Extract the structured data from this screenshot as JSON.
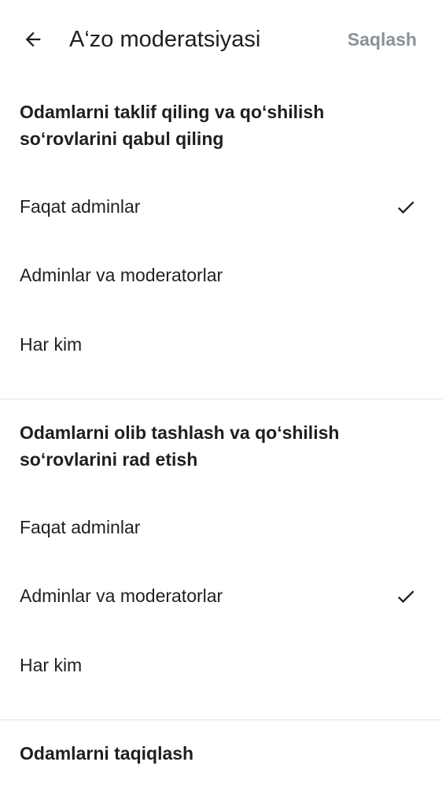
{
  "header": {
    "back_icon": "arrow-left-icon",
    "title": "A‘zo moderatsiyasi",
    "save_label": "Saqlash",
    "save_color": "#8a9199"
  },
  "sections": [
    {
      "title": "Odamlarni taklif qiling va qo‘shilish so‘rovlarini qabul qiling",
      "options": [
        {
          "label": "Faqat adminlar",
          "selected": true
        },
        {
          "label": "Adminlar va moderatorlar",
          "selected": false
        },
        {
          "label": "Har kim",
          "selected": false
        }
      ]
    },
    {
      "title": "Odamlarni olib tashlash va qo‘shilish so‘rovlarini rad etish",
      "options": [
        {
          "label": "Faqat adminlar",
          "selected": false
        },
        {
          "label": "Adminlar va moderatorlar",
          "selected": true
        },
        {
          "label": "Har kim",
          "selected": false
        }
      ]
    },
    {
      "title": "Odamlarni taqiqlash"
    }
  ],
  "colors": {
    "text": "#1f1f1f",
    "divider": "#e4e4e4",
    "background": "#ffffff"
  }
}
